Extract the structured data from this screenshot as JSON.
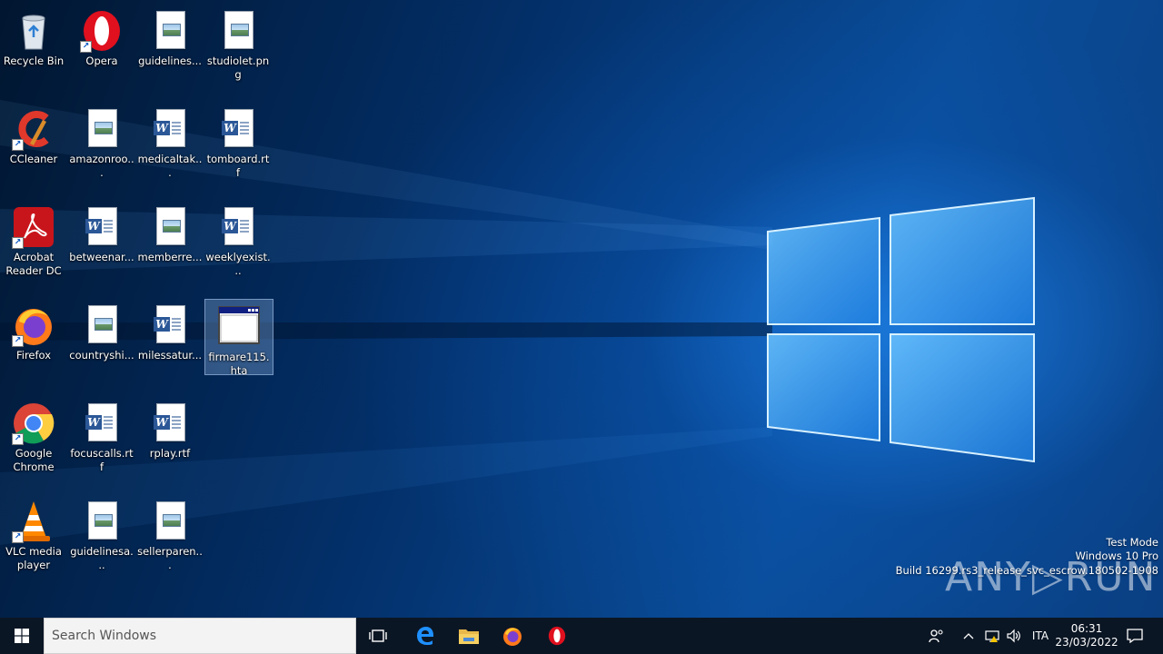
{
  "desktop": {
    "icons": [
      {
        "id": "recycle-bin",
        "label": "Recycle Bin"
      },
      {
        "id": "opera",
        "label": "Opera"
      },
      {
        "id": "guidelines",
        "label": "guidelines..."
      },
      {
        "id": "studiolet",
        "label": "studiolet.png"
      },
      {
        "id": "ccleaner",
        "label": "CCleaner"
      },
      {
        "id": "amazonroo",
        "label": "amazonroo..."
      },
      {
        "id": "medicaltak",
        "label": "medicaltak..."
      },
      {
        "id": "tomboard",
        "label": "tomboard.rtf"
      },
      {
        "id": "acrobat",
        "label": "Acrobat Reader DC"
      },
      {
        "id": "betweenar",
        "label": "betweenar..."
      },
      {
        "id": "memberre",
        "label": "memberre..."
      },
      {
        "id": "weeklyexist",
        "label": "weeklyexist..."
      },
      {
        "id": "firefox",
        "label": "Firefox"
      },
      {
        "id": "countryshi",
        "label": "countryshi..."
      },
      {
        "id": "milessatur",
        "label": "milessatur..."
      },
      {
        "id": "firmare115",
        "label": "firmare115.hta"
      },
      {
        "id": "chrome",
        "label": "Google Chrome"
      },
      {
        "id": "focuscalls",
        "label": "focuscalls.rtf"
      },
      {
        "id": "rplay",
        "label": "rplay.rtf"
      },
      {
        "id": "vlc",
        "label": "VLC media player"
      },
      {
        "id": "guidelinesa",
        "label": "guidelinesa..."
      },
      {
        "id": "sellerparen",
        "label": "sellerparen..."
      }
    ]
  },
  "watermark": {
    "mode": "Test Mode",
    "edition": "Windows 10 Pro",
    "build": "Build 16299.rs3_release_svc_escrow.180502-1908",
    "brand": "ANY RUN"
  },
  "taskbar": {
    "search_placeholder": "Search Windows",
    "language": "ITA",
    "time": "06:31",
    "date": "23/03/2022"
  },
  "colors": {
    "taskbar": "#0b1624",
    "accent": "#0078d7"
  }
}
